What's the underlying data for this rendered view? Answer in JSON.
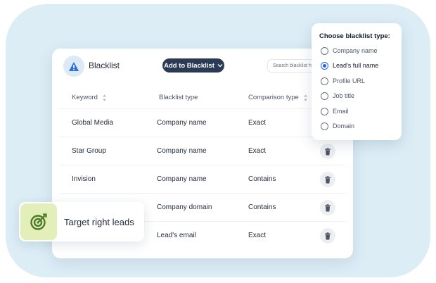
{
  "card": {
    "title": "Blacklist",
    "add_button_label": "Add to Blacklist",
    "search_placeholder": "Search blacklist h"
  },
  "table": {
    "columns": [
      "Keyword",
      "Blacklist type",
      "Comparison type"
    ],
    "rows": [
      {
        "keyword": "Global Media",
        "type": "Company name",
        "comparison": "Exact"
      },
      {
        "keyword": "Star Group",
        "type": "Company name",
        "comparison": "Exact"
      },
      {
        "keyword": "Invision",
        "type": "Company name",
        "comparison": "Contains"
      },
      {
        "keyword": "",
        "type": "Company domain",
        "comparison": "Contains"
      },
      {
        "keyword": "",
        "type": "Lead's email",
        "comparison": "Exact"
      }
    ]
  },
  "dropdown": {
    "title": "Choose blacklist type:",
    "options": [
      {
        "label": "Company name",
        "selected": false
      },
      {
        "label": "Lead's full name",
        "selected": true
      },
      {
        "label": "Profile URL",
        "selected": false
      },
      {
        "label": "Job title",
        "selected": false
      },
      {
        "label": "Email",
        "selected": false
      },
      {
        "label": "Domain",
        "selected": false
      }
    ]
  },
  "badge": {
    "label": "Target right leads"
  },
  "icons": {
    "warning": "warning-triangle-icon",
    "chevron": "chevron-down-icon",
    "sort": "sort-icon",
    "trash": "trash-icon",
    "target": "target-icon"
  },
  "colors": {
    "background_shape": "#dcedf6",
    "primary_button": "#2b3a55",
    "warning_icon": "#2f6fd6",
    "radio_selected": "#2563eb",
    "badge_icon_bg": "#e3efb8",
    "badge_icon_fg": "#4f7a2a"
  }
}
